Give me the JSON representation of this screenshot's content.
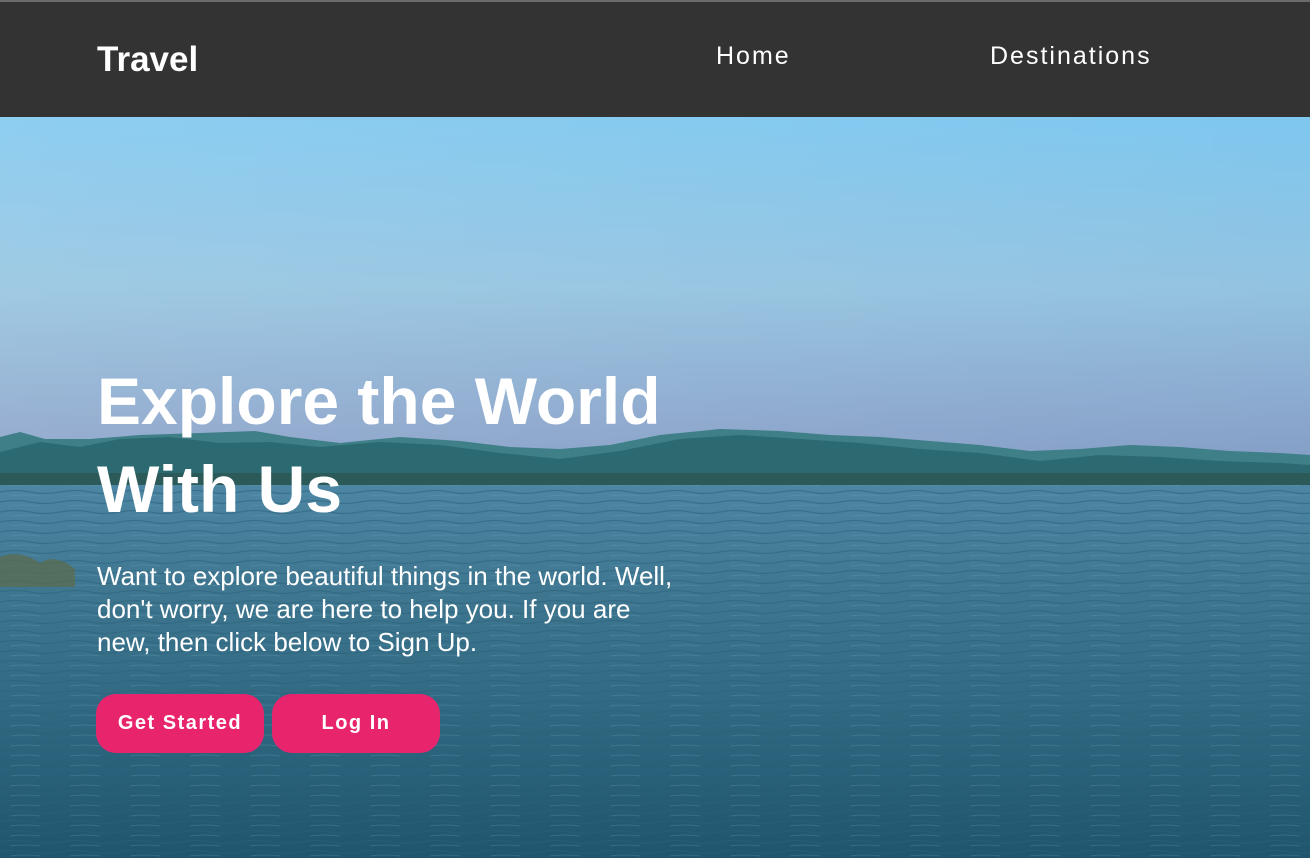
{
  "navbar": {
    "brand": "Travel",
    "links": [
      {
        "label": "Home"
      },
      {
        "label": "Destinations"
      }
    ]
  },
  "hero": {
    "title_line1": "Explore the World",
    "title_line2": "With Us",
    "description_line1": "Want to explore beautiful things in the world. Well,",
    "description_line2": "don't worry, we are here to help you. If you are",
    "description_line3": "new, then click below to Sign Up.",
    "buttons": [
      {
        "label": "Get Started"
      },
      {
        "label": "Log In"
      }
    ]
  },
  "colors": {
    "navbar_bg": "#333333",
    "accent": "#e8246d",
    "text": "#ffffff"
  }
}
